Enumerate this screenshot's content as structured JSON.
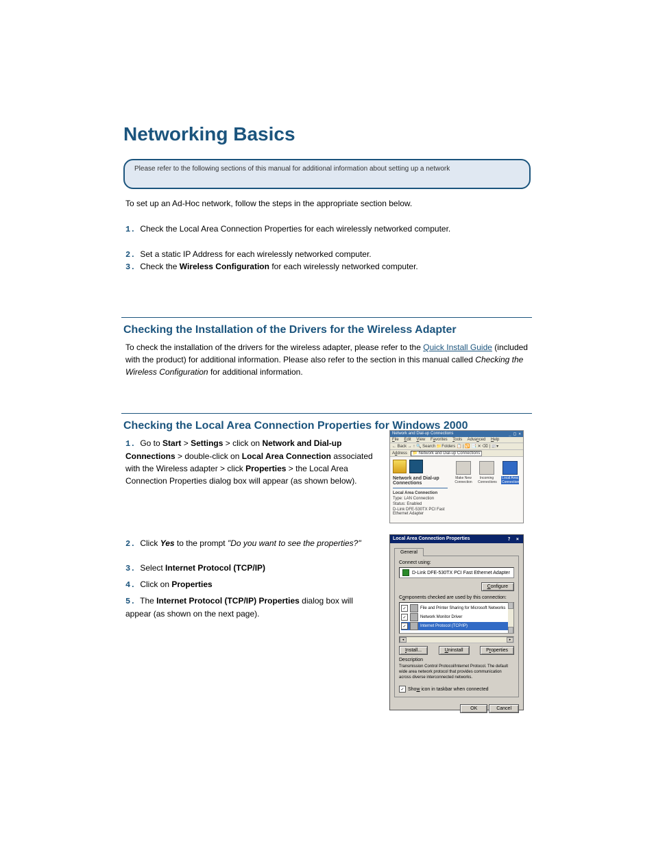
{
  "title": "Networking Basics",
  "callout": "Please refer to the following sections of this manual for additional information about setting up a network",
  "intro": {
    "line1": "To set up an Ad-Hoc network, follow the steps in the appropriate section below.",
    "step1": "Check the Local Area Connection Properties for each wirelessly networked computer.",
    "step2": "Set a static IP Address for each wirelessly networked computer.",
    "step3a": "Check the",
    "step3b": "Wireless Configuration",
    "step3c": "for each wirelessly networked computer."
  },
  "sec1": {
    "head": "Checking the Installation of the Drivers for the Wireless Adapter",
    "body_a": "To check the installation of the drivers for the wireless adapter, please refer to the ",
    "body_link": "Quick Install Guide",
    "body_b": " (included with the product) for additional information.  Please also refer to the section in this manual called ",
    "body_c": "Checking the Wireless Configuration",
    "body_d": " for additional information."
  },
  "sec2": {
    "head": "Checking the Local Area Connection Properties for Windows 2000",
    "s1a": "Go to ",
    "s1b": "Start",
    "s1c": " > ",
    "s1d": "Settings",
    "s1e": " > click on ",
    "s1f": "Network and Dial-up Connections",
    "s1g": " > double-click on ",
    "s1h": "Local Area Connection",
    "s1i": " associated with the Wireless adapter > click ",
    "s1j": "Properties",
    "s1k": " > the Local Area Connection Properties dialog box will appear (as shown below).",
    "s2a": "Click ",
    "s2b": "Yes",
    "s2c": " to the prompt ",
    "s2d": "\"Do you want to see the properties?\"",
    "s3a": "Select ",
    "s3b": "Internet Protocol (TCP/IP)",
    "s4a": "Click on ",
    "s4b": "Properties",
    "s5a": "The ",
    "s5b": "Internet Protocol (TCP/IP) Properties",
    "s5c": " dialog box will appear (as shown on the next page)."
  },
  "shot1": {
    "title": "Network and Dial-up Connections",
    "menus": [
      "File",
      "Edit",
      "View",
      "Favorites",
      "Tools",
      "Advanced",
      "Help"
    ],
    "toolbar": "← Back  →  ↑   🔍 Search  📁Folders  📋  | 🔁 📑 ✕ ⌫ | 📰▾",
    "address_lbl": "Address",
    "address_val": "Network and Dial-up Connections",
    "left_head": "Network and Dial-up Connections",
    "left_sub": "Local Area Connection",
    "left_type": "Type: LAN Connection",
    "left_status": "Status: Enabled",
    "left_adapter": "D-Link DFE-530TX PCI Fast Ethernet Adapter",
    "icons": [
      {
        "label": "Make New Connection"
      },
      {
        "label": "Incoming Connections"
      },
      {
        "label": "Local Area Connection"
      }
    ]
  },
  "shot2": {
    "title": "Local Area Connection Properties",
    "tab": "General",
    "connect_using": "Connect using:",
    "adapter": "D-Link DFE-530TX PCI Fast Ethernet Adapter",
    "configure": "Configure",
    "components": "Components checked are used by this connection:",
    "items": [
      "File and Printer Sharing for Microsoft Networks",
      "Network Monitor Driver",
      "Internet Protocol (TCP/IP)"
    ],
    "install": "Install...",
    "uninstall": "Uninstall",
    "properties": "Properties",
    "desc_lbl": "Description",
    "desc_txt": "Transmission Control Protocol/Internet Protocol. The default wide area network protocol that provides communication across diverse interconnected networks.",
    "show": "Show icon in taskbar when connected",
    "ok": "OK",
    "cancel": "Cancel"
  }
}
